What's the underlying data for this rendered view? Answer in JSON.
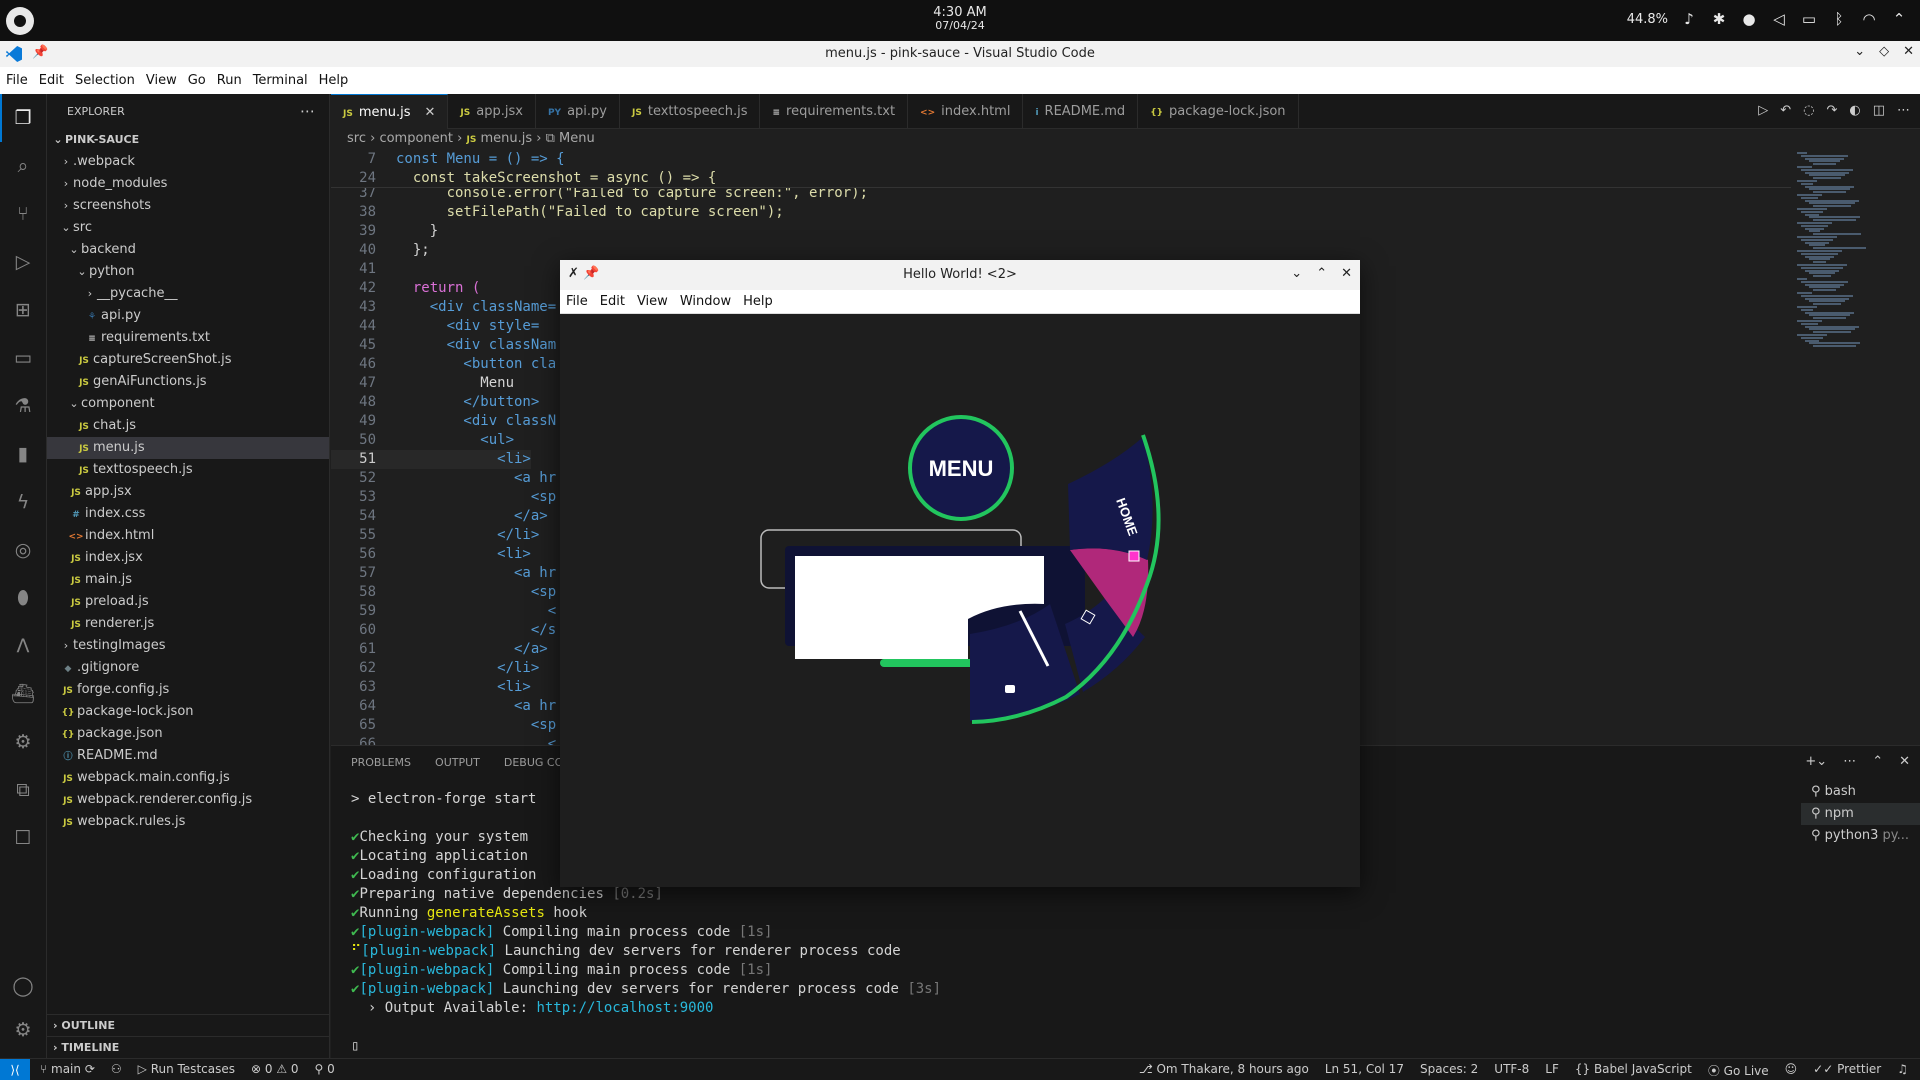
{
  "system": {
    "time": "4:30 AM",
    "date": "07/04/24",
    "battery": "44.8%"
  },
  "window": {
    "title": "menu.js - pink-sauce - Visual Studio Code"
  },
  "menubar": [
    "File",
    "Edit",
    "Selection",
    "View",
    "Go",
    "Run",
    "Terminal",
    "Help"
  ],
  "explorer": {
    "header": "EXPLORER",
    "root": "PINK-SAUCE",
    "items": [
      {
        "label": ".webpack",
        "kind": "folder",
        "depth": 1,
        "open": false
      },
      {
        "label": "node_modules",
        "kind": "folder",
        "depth": 1,
        "open": false
      },
      {
        "label": "screenshots",
        "kind": "folder",
        "depth": 1,
        "open": false
      },
      {
        "label": "src",
        "kind": "folder",
        "depth": 1,
        "open": true
      },
      {
        "label": "backend",
        "kind": "folder",
        "depth": 2,
        "open": true
      },
      {
        "label": "python",
        "kind": "folder",
        "depth": 3,
        "open": true
      },
      {
        "label": "__pycache__",
        "kind": "folder",
        "depth": 4,
        "open": false
      },
      {
        "label": "api.py",
        "kind": "py",
        "depth": 4
      },
      {
        "label": "requirements.txt",
        "kind": "txt",
        "depth": 4
      },
      {
        "label": "captureScreenShot.js",
        "kind": "js",
        "depth": 3
      },
      {
        "label": "genAiFunctions.js",
        "kind": "js",
        "depth": 3
      },
      {
        "label": "component",
        "kind": "folder",
        "depth": 2,
        "open": true
      },
      {
        "label": "chat.js",
        "kind": "js",
        "depth": 3
      },
      {
        "label": "menu.js",
        "kind": "js",
        "depth": 3,
        "selected": true
      },
      {
        "label": "texttospeech.js",
        "kind": "js",
        "depth": 3
      },
      {
        "label": "app.jsx",
        "kind": "js",
        "depth": 2
      },
      {
        "label": "index.css",
        "kind": "css",
        "depth": 2
      },
      {
        "label": "index.html",
        "kind": "html",
        "depth": 2
      },
      {
        "label": "index.jsx",
        "kind": "js",
        "depth": 2
      },
      {
        "label": "main.js",
        "kind": "js",
        "depth": 2
      },
      {
        "label": "preload.js",
        "kind": "js",
        "depth": 2
      },
      {
        "label": "renderer.js",
        "kind": "js",
        "depth": 2
      },
      {
        "label": "testingImages",
        "kind": "folder",
        "depth": 1,
        "open": false
      },
      {
        "label": ".gitignore",
        "kind": "git",
        "depth": 1
      },
      {
        "label": "forge.config.js",
        "kind": "js",
        "depth": 1
      },
      {
        "label": "package-lock.json",
        "kind": "json",
        "depth": 1
      },
      {
        "label": "package.json",
        "kind": "json",
        "depth": 1
      },
      {
        "label": "README.md",
        "kind": "md",
        "depth": 1
      },
      {
        "label": "webpack.main.config.js",
        "kind": "js",
        "depth": 1
      },
      {
        "label": "webpack.renderer.config.js",
        "kind": "js",
        "depth": 1
      },
      {
        "label": "webpack.rules.js",
        "kind": "js",
        "depth": 1
      }
    ],
    "outline": "OUTLINE",
    "timeline": "TIMELINE"
  },
  "tabs": [
    {
      "label": "menu.js",
      "icon": "JS",
      "active": true
    },
    {
      "label": "app.jsx",
      "icon": "JS"
    },
    {
      "label": "api.py",
      "icon": "PY"
    },
    {
      "label": "texttospeech.js",
      "icon": "JS"
    },
    {
      "label": "requirements.txt",
      "icon": "≡"
    },
    {
      "label": "index.html",
      "icon": "<>"
    },
    {
      "label": "README.md",
      "icon": "i"
    },
    {
      "label": "package-lock.json",
      "icon": "{}"
    }
  ],
  "breadcrumb": {
    "p1": "src",
    "p2": "component",
    "p3": "menu.js",
    "p4": "Menu"
  },
  "code": {
    "sticky1_ln": "7",
    "sticky1": "const Menu = () => {",
    "sticky2_ln": "24",
    "sticky2": "  const takeScreenshot = async () => {",
    "lines": [
      {
        "ln": "37",
        "text": "      console.error(\"Failed to capture screen:\", error);"
      },
      {
        "ln": "38",
        "text": "      setFilePath(\"Failed to capture screen\");"
      },
      {
        "ln": "39",
        "text": "    }"
      },
      {
        "ln": "40",
        "text": "  };"
      },
      {
        "ln": "41",
        "text": ""
      },
      {
        "ln": "42",
        "text": "  return ("
      },
      {
        "ln": "43",
        "text": "    <div className="
      },
      {
        "ln": "44",
        "text": "      <div style="
      },
      {
        "ln": "45",
        "text": "      <div classNam"
      },
      {
        "ln": "46",
        "text": "        <button cla"
      },
      {
        "ln": "47",
        "text": "          Menu"
      },
      {
        "ln": "48",
        "text": "        </button>"
      },
      {
        "ln": "49",
        "text": "        <div classN"
      },
      {
        "ln": "50",
        "text": "          <ul>"
      },
      {
        "ln": "51",
        "text": "            <li>"
      },
      {
        "ln": "52",
        "text": "              <a hr"
      },
      {
        "ln": "53",
        "text": "                <sp"
      },
      {
        "ln": "54",
        "text": "              </a>"
      },
      {
        "ln": "55",
        "text": "            </li>"
      },
      {
        "ln": "56",
        "text": "            <li>"
      },
      {
        "ln": "57",
        "text": "              <a hr"
      },
      {
        "ln": "58",
        "text": "                <sp"
      },
      {
        "ln": "59",
        "text": "                  <"
      },
      {
        "ln": "60",
        "text": "                </s"
      },
      {
        "ln": "61",
        "text": "              </a>"
      },
      {
        "ln": "62",
        "text": "            </li>"
      },
      {
        "ln": "63",
        "text": "            <li>"
      },
      {
        "ln": "64",
        "text": "              <a hr"
      },
      {
        "ln": "65",
        "text": "                <sp"
      },
      {
        "ln": "66",
        "text": "                  <"
      }
    ],
    "current_line": "51"
  },
  "panel": {
    "tabs": [
      "PROBLEMS",
      "OUTPUT",
      "DEBUG CON"
    ],
    "terminal": [
      {
        "parts": [
          {
            "t": "> electron-forge start",
            "c": "pl"
          }
        ]
      },
      {
        "parts": [
          {
            "t": "",
            "c": "pl"
          }
        ]
      },
      {
        "parts": [
          {
            "t": "✔",
            "c": "ok"
          },
          {
            "t": "Checking your system",
            "c": "pl"
          }
        ]
      },
      {
        "parts": [
          {
            "t": "✔",
            "c": "ok"
          },
          {
            "t": "Locating application",
            "c": "pl"
          }
        ]
      },
      {
        "parts": [
          {
            "t": "✔",
            "c": "ok"
          },
          {
            "t": "Loading configuration",
            "c": "pl"
          }
        ]
      },
      {
        "parts": [
          {
            "t": "✔",
            "c": "ok"
          },
          {
            "t": "Preparing native dependencies ",
            "c": "pl"
          },
          {
            "t": "[0.2s]",
            "c": "dim"
          }
        ]
      },
      {
        "parts": [
          {
            "t": "✔",
            "c": "ok"
          },
          {
            "t": "Running ",
            "c": "pl"
          },
          {
            "t": "generateAssets",
            "c": "ye"
          },
          {
            "t": " hook",
            "c": "pl"
          }
        ]
      },
      {
        "parts": [
          {
            "t": "✔",
            "c": "ok"
          },
          {
            "t": "[plugin-webpack]",
            "c": "cy"
          },
          {
            "t": " Compiling main process code ",
            "c": "pl"
          },
          {
            "t": "[1s]",
            "c": "dim"
          }
        ]
      },
      {
        "parts": [
          {
            "t": "⠋",
            "c": "ye"
          },
          {
            "t": "[plugin-webpack]",
            "c": "cy"
          },
          {
            "t": " Launching dev servers for renderer process code",
            "c": "pl"
          }
        ]
      },
      {
        "parts": [
          {
            "t": "✔",
            "c": "ok"
          },
          {
            "t": "[plugin-webpack]",
            "c": "cy"
          },
          {
            "t": " Compiling main process code ",
            "c": "pl"
          },
          {
            "t": "[1s]",
            "c": "dim"
          }
        ]
      },
      {
        "parts": [
          {
            "t": "✔",
            "c": "ok"
          },
          {
            "t": "[plugin-webpack]",
            "c": "cy"
          },
          {
            "t": " Launching dev servers for renderer process code ",
            "c": "pl"
          },
          {
            "t": "[3s]",
            "c": "dim"
          }
        ]
      },
      {
        "parts": [
          {
            "t": "  › Output Available: ",
            "c": "pl"
          },
          {
            "t": "http://localhost:9000",
            "c": "cy"
          }
        ]
      },
      {
        "parts": [
          {
            "t": "",
            "c": "pl"
          }
        ]
      },
      {
        "parts": [
          {
            "t": "▯",
            "c": "pl"
          }
        ]
      }
    ],
    "terminals": [
      "bash",
      "npm",
      "python3",
      "py..."
    ]
  },
  "statusbar": {
    "branch": "main",
    "run_tests": "Run Testcases",
    "errors": "0",
    "warnings": "0",
    "ports": "0",
    "blame": "Om Thakare, 8 hours ago",
    "position": "Ln 51, Col 17",
    "spaces": "Spaces: 2",
    "encoding": "UTF-8",
    "eol": "LF",
    "language": "Babel JavaScript",
    "golive": "Go Live",
    "prettier": "Prettier"
  },
  "app_window": {
    "title": "Hello World! <2>",
    "menu": [
      "File",
      "Edit",
      "View",
      "Window",
      "Help"
    ],
    "menu_button": "MENU",
    "home_label": "HOME",
    "colors": {
      "accent": "#22c55e",
      "navy": "#15184a",
      "pink": "#b0287a"
    }
  }
}
